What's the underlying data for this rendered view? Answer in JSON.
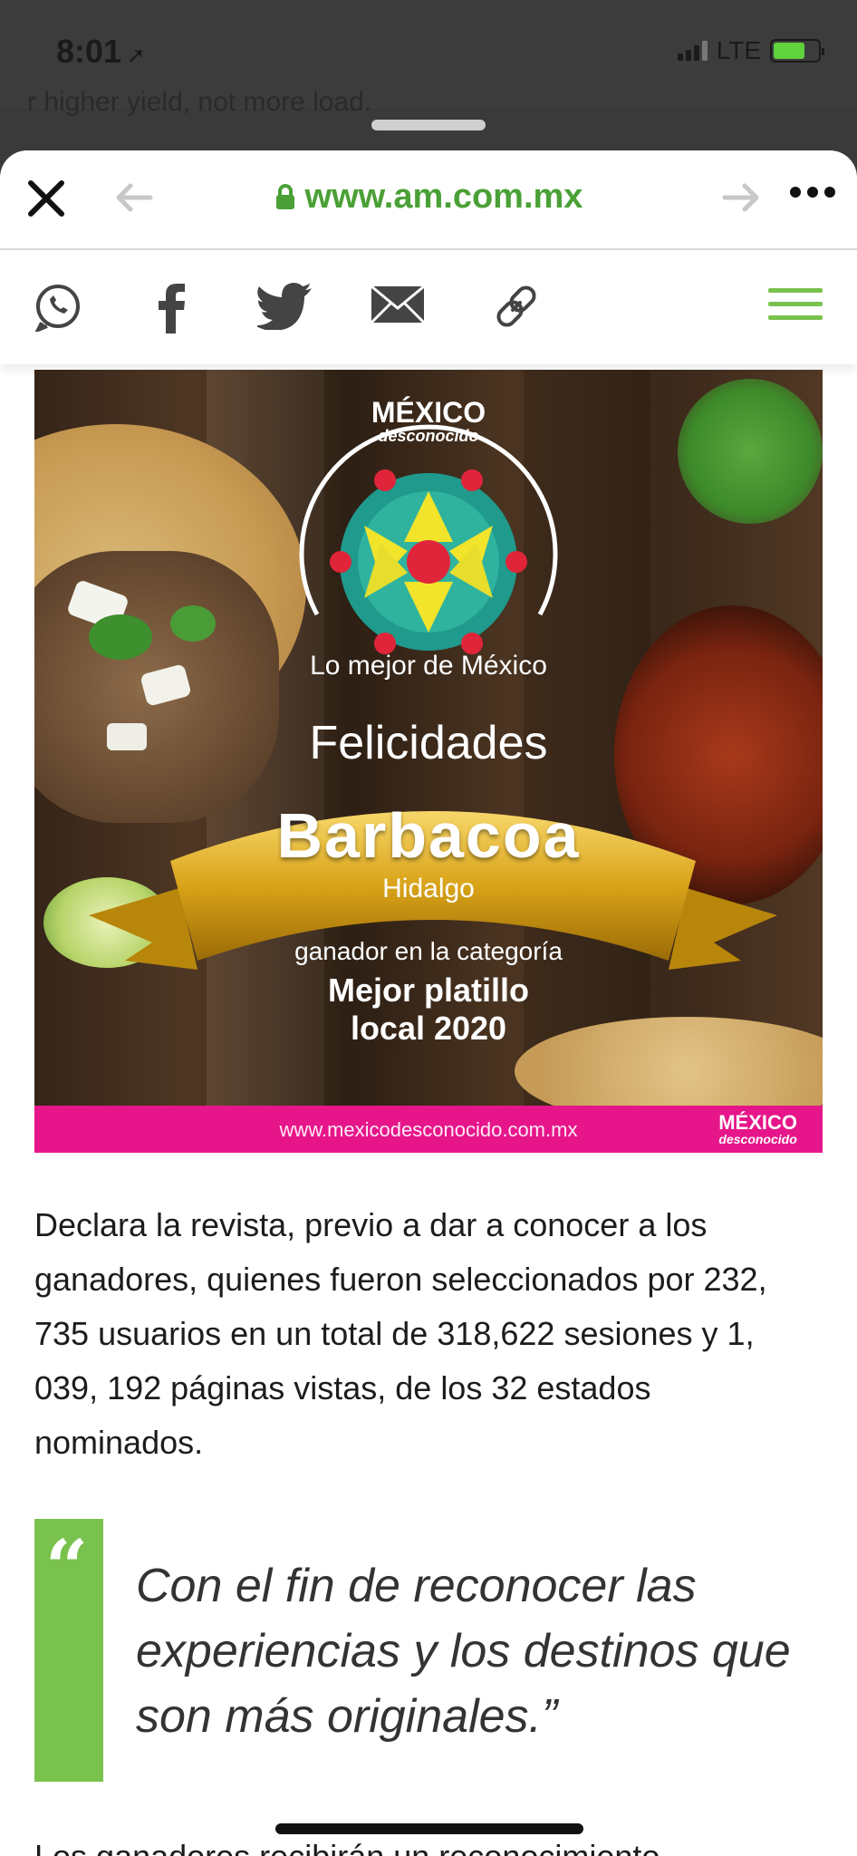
{
  "status_bar": {
    "time": "8:01",
    "carrier": "LTE"
  },
  "background_page_text": "r higher yield, not more load.",
  "browser": {
    "url": "www.am.com.mx"
  },
  "share_bar": {
    "icons": [
      "whatsapp-icon",
      "facebook-icon",
      "twitter-icon",
      "mail-icon",
      "link-icon",
      "menu-icon"
    ],
    "accent_color": "#7ac24e"
  },
  "hero": {
    "brand_top": "MÉXICO",
    "brand_bottom": "desconocido",
    "arc_text": "Lo mejor de México",
    "felicidades": "Felicidades",
    "ribbon_title": "Barbacoa",
    "ribbon_sub": "Hidalgo",
    "category_line": "ganador en la categoría",
    "award_line1": "Mejor platillo",
    "award_line2": "local 2020",
    "footer_url": "www.mexicodesconocido.com.mx",
    "footer_brand_top": "MÉXICO",
    "footer_brand_bottom": "desconocido",
    "footer_color": "#e6168a"
  },
  "article": {
    "paragraph": "Declara la revista, previo a dar a conocer a los ganadores, quienes fueron seleccionados por 232, 735 usuarios en un total de 318,622 sesiones y 1, 039, 192 páginas vistas, de los 32 estados nominados.",
    "quote_mark": "“",
    "quote": "Con el fin de reconocer las experiencias y los destinos que son más originales.”",
    "next_paragraph_start": "Los ganadores recibirán un reconocimiento"
  }
}
